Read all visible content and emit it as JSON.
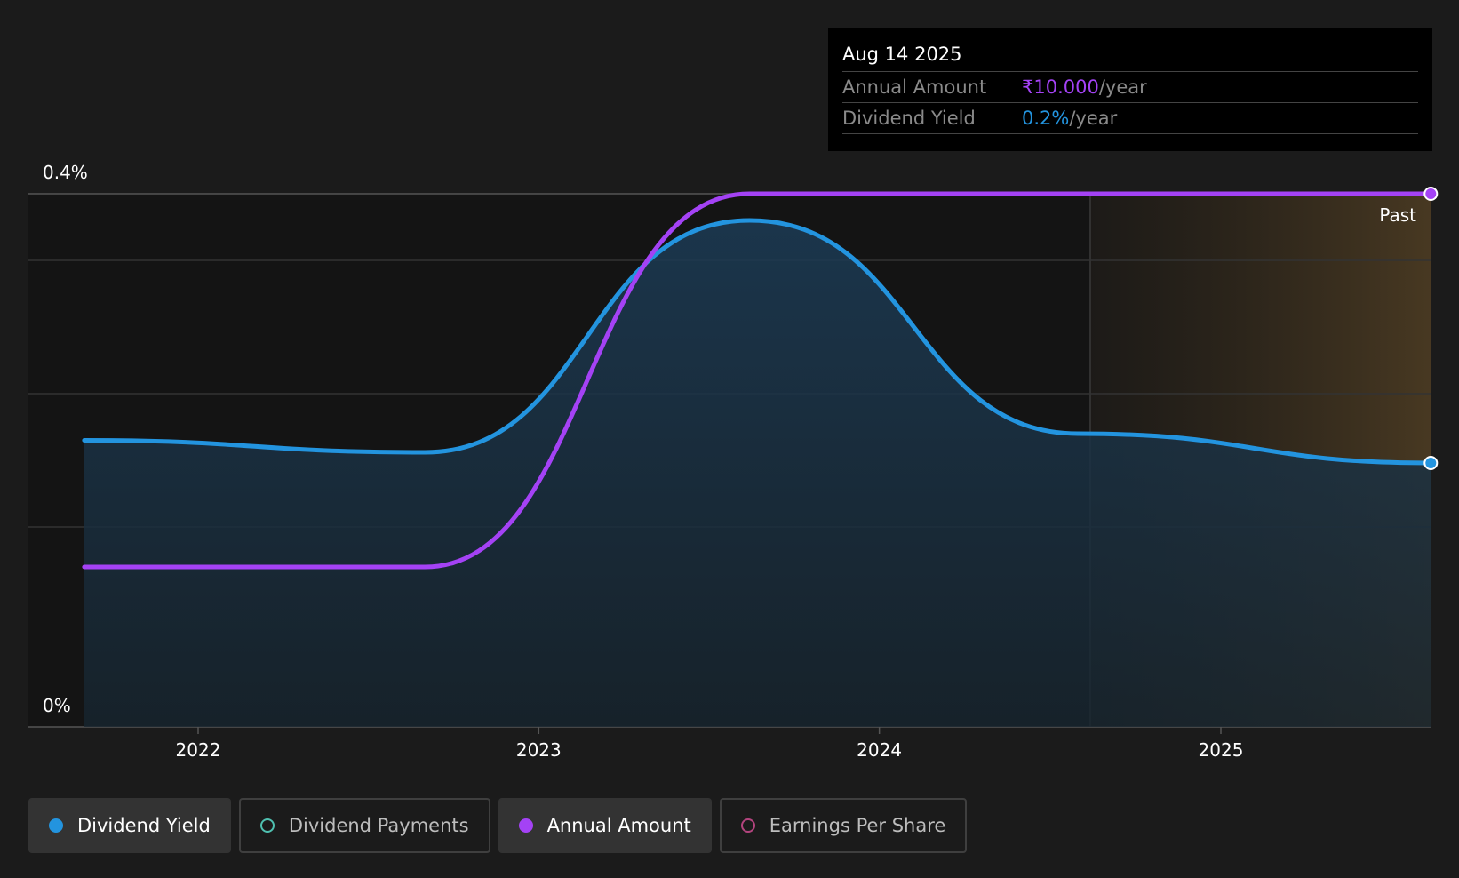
{
  "chart_data": {
    "type": "line",
    "x_ticks": [
      "2022",
      "2023",
      "2024",
      "2025"
    ],
    "y_ticks": [
      "0.4%",
      "0%"
    ],
    "ylim": [
      0,
      0.4
    ],
    "regions": [
      {
        "label": "Past",
        "from": "2024-08-14",
        "to": "2025-08-14"
      }
    ],
    "series": [
      {
        "name": "Dividend Yield",
        "color": "#2394df",
        "unit": "%",
        "points": [
          [
            "2021-09-01",
            0.215
          ],
          [
            "2022-09-01",
            0.206
          ],
          [
            "2023-08-15",
            0.38
          ],
          [
            "2024-08-01",
            0.22
          ],
          [
            "2025-08-14",
            0.198
          ]
        ]
      },
      {
        "name": "Annual Amount",
        "color": "#a442f5",
        "unit": "₹",
        "points": [
          [
            "2021-09-01",
            0.12
          ],
          [
            "2022-09-01",
            0.12
          ],
          [
            "2023-08-15",
            0.4
          ],
          [
            "2025-08-14",
            0.4
          ]
        ]
      }
    ],
    "legend": "bottom"
  },
  "tooltip": {
    "date": "Aug 14 2025",
    "rows": [
      {
        "label": "Annual Amount",
        "value": "₹10.000",
        "unit": "/year",
        "color": "#a442f5"
      },
      {
        "label": "Dividend Yield",
        "value": "0.2%",
        "unit": "/year",
        "color": "#2394df"
      }
    ]
  },
  "legend": [
    {
      "label": "Dividend Yield",
      "color": "#2394df",
      "active": true,
      "filled": true,
      "icon": "filled-dot-icon"
    },
    {
      "label": "Dividend Payments",
      "color": "#4fc0b0",
      "active": false,
      "filled": false,
      "icon": "hollow-dot-icon"
    },
    {
      "label": "Annual Amount",
      "color": "#a442f5",
      "active": true,
      "filled": true,
      "icon": "filled-dot-icon"
    },
    {
      "label": "Earnings Per Share",
      "color": "#b3447e",
      "active": false,
      "filled": false,
      "icon": "hollow-dot-icon"
    }
  ]
}
